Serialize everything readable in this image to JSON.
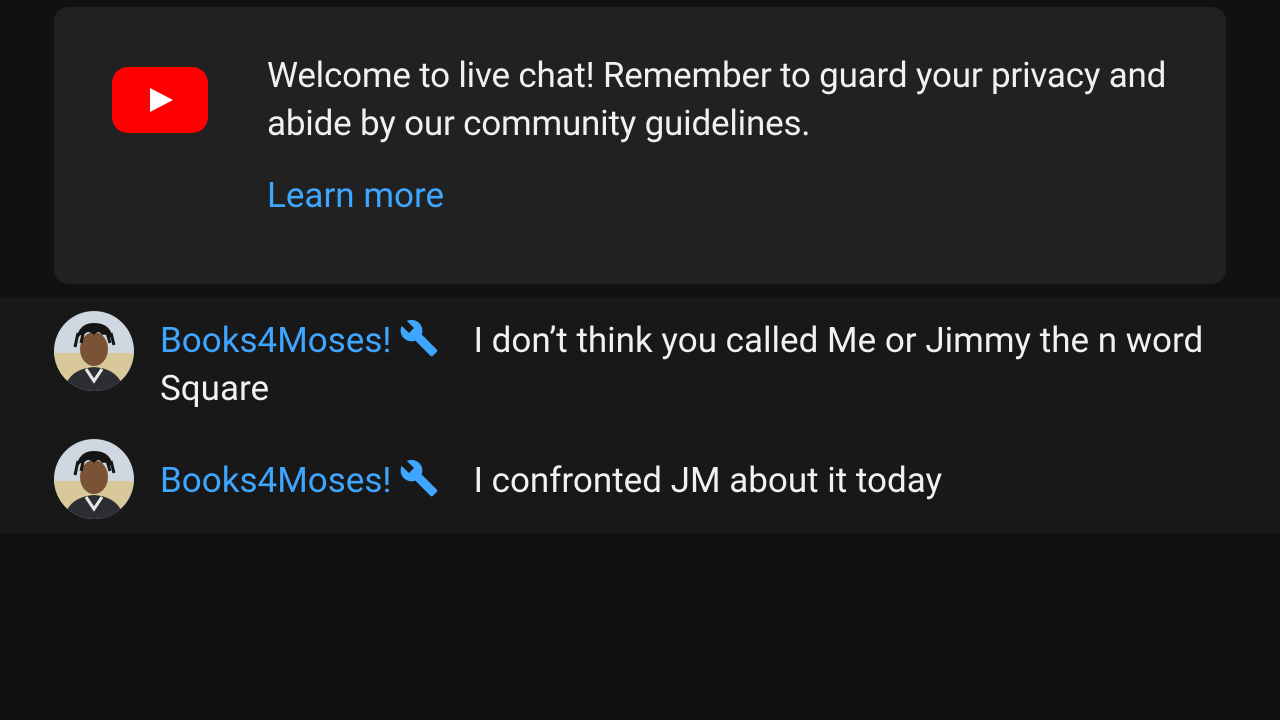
{
  "banner": {
    "message": "Welcome to live chat! Remember to guard your privacy and abide by our community guidelines.",
    "learn_more": "Learn more",
    "logo_icon": "youtube-logo-icon",
    "logo_color": "#ff0000"
  },
  "messages": [
    {
      "author": "Books4Moses!",
      "badge_icon": "wrench-icon",
      "text": "I don’t think you called Me or Jimmy the n word Square"
    },
    {
      "author": "Books4Moses!",
      "badge_icon": "wrench-icon",
      "text": "I confronted JM about it today"
    }
  ],
  "colors": {
    "author": "#3ea6ff",
    "badge": "#3ea6ff",
    "link": "#3ea6ff"
  }
}
